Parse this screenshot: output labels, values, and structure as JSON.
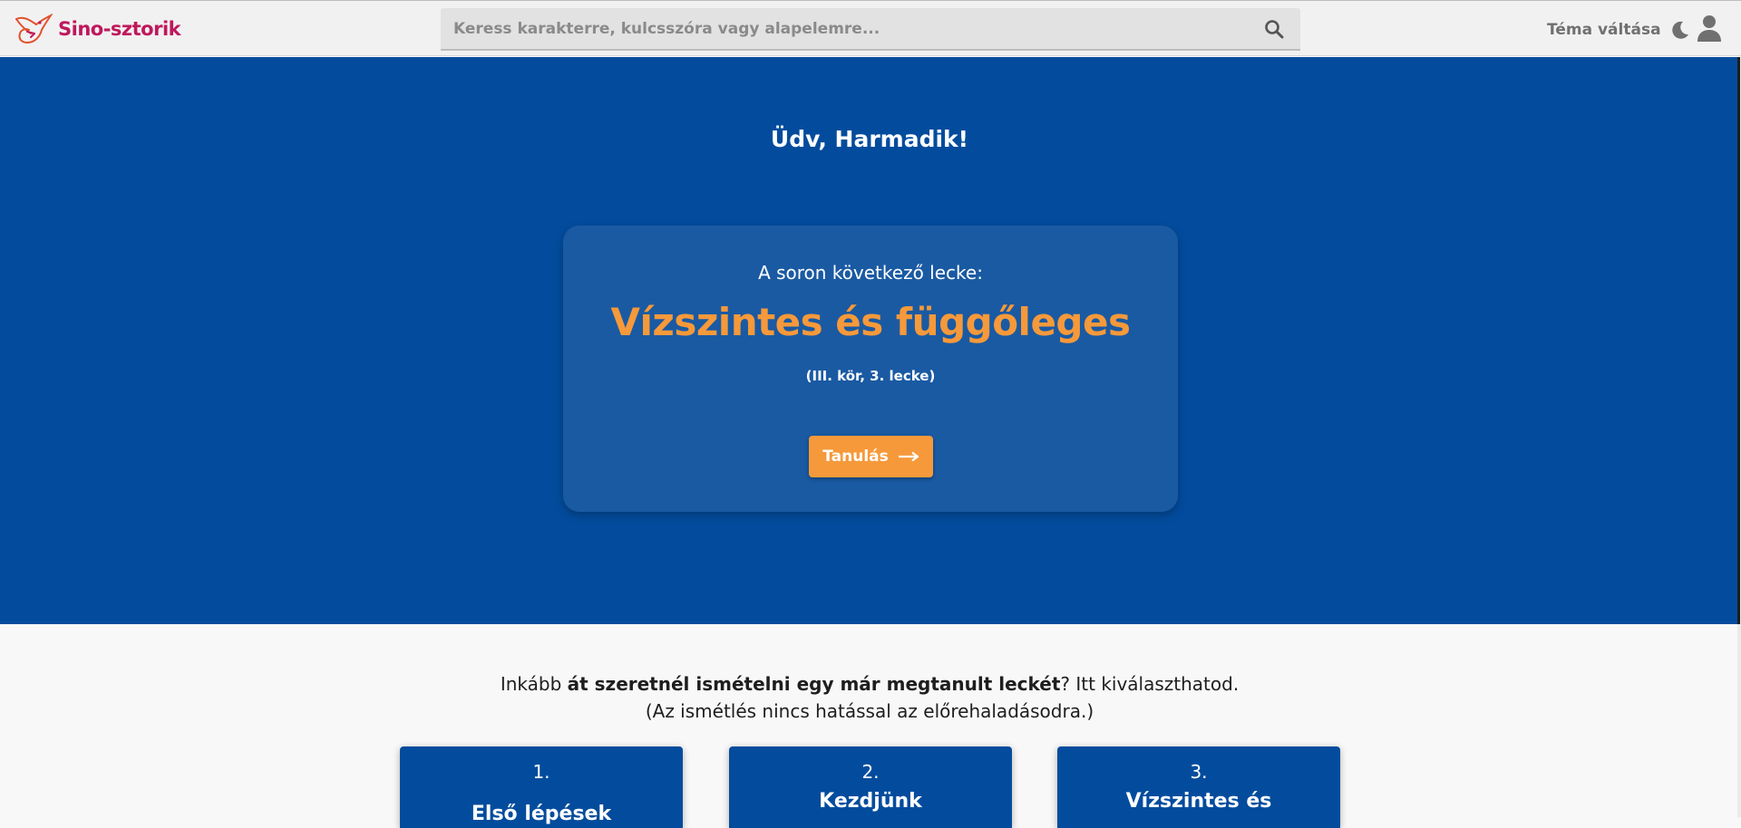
{
  "header": {
    "brand": "Sino-sztorik",
    "search_placeholder": "Keress karakterre, kulcsszóra vagy alapelemre...",
    "theme_label": "Téma váltása",
    "colors": {
      "brand": "#c0185c",
      "header_bg": "#f1f1f1"
    },
    "icons": [
      "logo-mark-icon",
      "search-icon",
      "moon-icon",
      "user-icon"
    ]
  },
  "hero": {
    "greeting": "Üdv, Harmadik!",
    "next_label": "A soron következő lecke:",
    "lesson_title": "Vízszintes és függőleges",
    "lesson_meta": "(III. kör, 3. lecke)",
    "learn_button": "Tanulás",
    "colors": {
      "background": "#034c9d",
      "card": "#1a5aa3",
      "accent": "#f6993a"
    }
  },
  "review": {
    "intro_prefix": "Inkább ",
    "intro_bold": "át szeretnél ismételni egy már megtanult leckét",
    "intro_suffix": "? Itt kiválaszthatod.",
    "intro_note": "(Az ismétlés nincs hatással az előrehaladásodra.)",
    "lessons": [
      {
        "number": "1.",
        "title": "Első lépések"
      },
      {
        "number": "2.",
        "title": "Kezdjünk"
      },
      {
        "number": "3.",
        "title": "Vízszintes és"
      }
    ]
  }
}
